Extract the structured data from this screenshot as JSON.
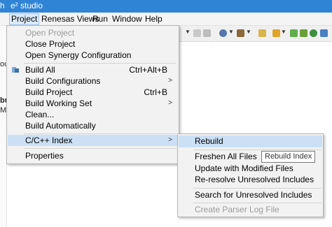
{
  "app": {
    "title": "e² studio",
    "title_prefix": "h"
  },
  "menubar": {
    "items": [
      "Project",
      "Renesas Views",
      "Run",
      "Window",
      "Help"
    ]
  },
  "left_fragments": [
    "out",
    "bu",
    "M"
  ],
  "project_menu": [
    {
      "label": "Open Project",
      "disabled": true
    },
    {
      "label": "Close Project"
    },
    {
      "label": "Open Synergy Configuration"
    },
    {
      "label": "Build All",
      "accel": "Ctrl+Alt+B",
      "icon": "build-all-icon"
    },
    {
      "label": "Build Configurations",
      "submenu": true
    },
    {
      "label": "Build Project",
      "accel": "Ctrl+B"
    },
    {
      "label": "Build Working Set",
      "submenu": true
    },
    {
      "label": "Clean..."
    },
    {
      "label": "Build Automatically"
    },
    {
      "label": "C/C++ Index",
      "submenu": true,
      "highlighted": true
    },
    {
      "label": "Properties"
    }
  ],
  "index_submenu": [
    {
      "label": "Rebuild",
      "highlighted": true
    },
    {
      "label": "Freshen All Files"
    },
    {
      "label": "Update with Modified Files"
    },
    {
      "label": "Re-resolve Unresolved Includes"
    },
    {
      "label": "Search for Unresolved Includes"
    },
    {
      "label": "Create Parser Log File",
      "disabled": true
    }
  ],
  "tooltip": "Rebuild Index",
  "submenu_arrow": ">"
}
